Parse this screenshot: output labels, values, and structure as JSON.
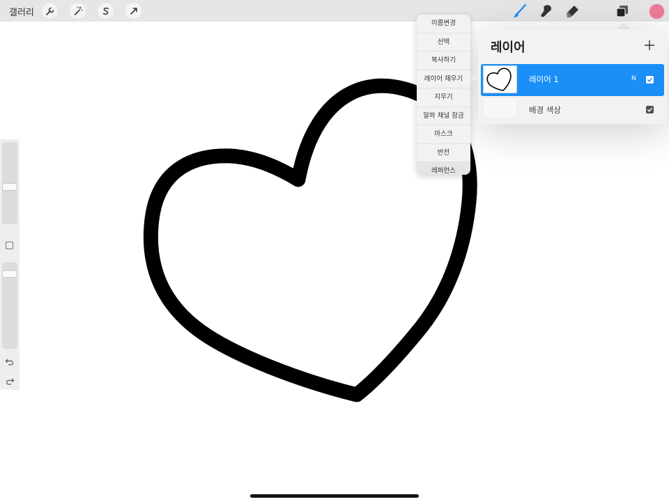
{
  "topbar": {
    "gallery_label": "갤러리",
    "left_tools": [
      "wrench-icon",
      "magic-wand-icon",
      "selection-s-icon",
      "transform-arrow-icon"
    ],
    "right_tools": [
      "brush-icon",
      "smudge-icon",
      "eraser-icon",
      "layers-icon"
    ],
    "active_tool": "brush-icon",
    "accent_color": "#1a8ff7",
    "current_color": "#f07a98"
  },
  "sidebar": {
    "brush_size_level": 0.45,
    "opacity_level": 0.9
  },
  "context_menu": {
    "items": [
      "이름변경",
      "선택",
      "복사하기",
      "레이어 채우기",
      "지우기",
      "알파 채널 잠금",
      "마스크",
      "반전",
      "레퍼런스"
    ]
  },
  "layers_panel": {
    "title": "레이어",
    "layers": [
      {
        "name": "레이어 1",
        "blend_mode": "N",
        "visible": true,
        "selected": true
      },
      {
        "name": "배경 색상",
        "visible": true,
        "selected": false
      }
    ]
  }
}
